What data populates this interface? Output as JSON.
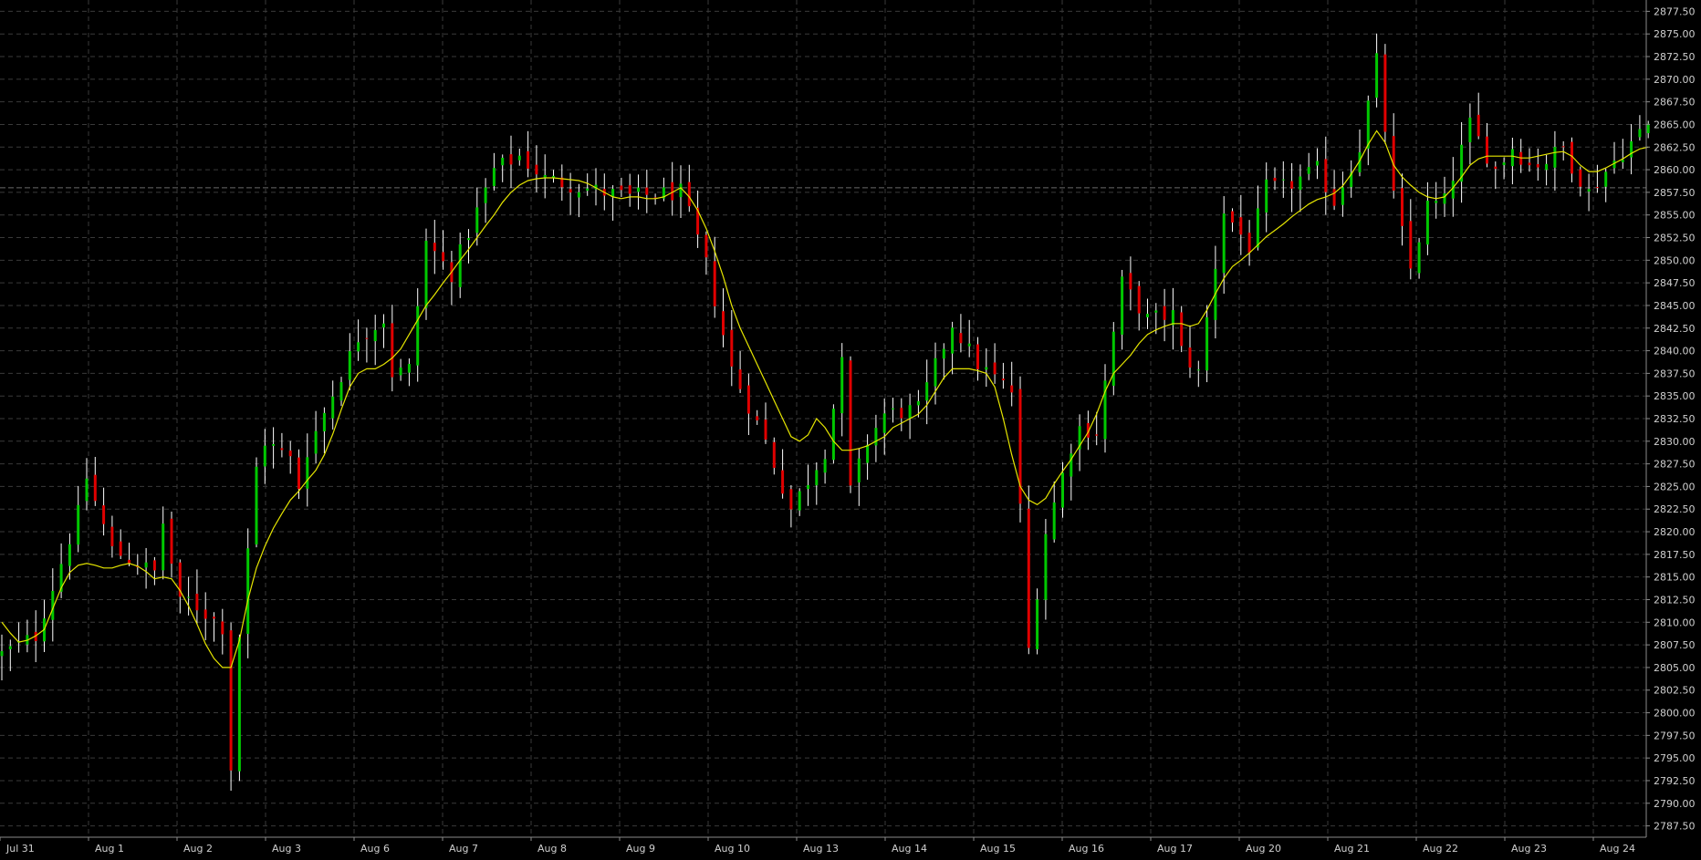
{
  "colors": {
    "background": "#000000",
    "grid": "#3a3a3a",
    "bull": "#00c800",
    "bear": "#e00000",
    "wick": "#ffffff",
    "moving_average": "#e6e600",
    "crosshair": "#6a6a6a",
    "axis_text": "#cfcfcf"
  },
  "chart_data": {
    "type": "candlestick",
    "title": "",
    "xlabel": "",
    "ylabel": "",
    "ylim": [
      2786.25,
      2878.75
    ],
    "y_ticks": [
      "2787.50",
      "2790.00",
      "2792.50",
      "2795.00",
      "2797.50",
      "2800.00",
      "2802.50",
      "2805.00",
      "2807.50",
      "2810.00",
      "2812.50",
      "2815.00",
      "2817.50",
      "2820.00",
      "2822.50",
      "2825.00",
      "2827.50",
      "2830.00",
      "2832.50",
      "2835.00",
      "2837.50",
      "2840.00",
      "2842.50",
      "2845.00",
      "2847.50",
      "2850.00",
      "2852.50",
      "2855.00",
      "2857.50",
      "2860.00",
      "2862.50",
      "2865.00",
      "2867.50",
      "2870.00",
      "2872.50",
      "2875.00",
      "2877.50"
    ],
    "x_ticks": [
      "Jul 31",
      "Aug 1",
      "Aug 2",
      "Aug 3",
      "Aug 6",
      "Aug 7",
      "Aug 8",
      "Aug 9",
      "Aug 10",
      "Aug 13",
      "Aug 14",
      "Aug 15",
      "Aug 16",
      "Aug 17",
      "Aug 20",
      "Aug 21",
      "Aug 22",
      "Aug 23",
      "Aug 24"
    ],
    "grid": true,
    "crosshair_price": 2858.0,
    "series": [
      {
        "type": "candlestick",
        "close_path": [
          [
            0,
            2806.5
          ],
          [
            4,
            2808.5
          ],
          [
            9,
            2822.0
          ],
          [
            10,
            2826.0
          ],
          [
            13,
            2818.0
          ],
          [
            18,
            2815.5
          ],
          [
            19,
            2821.0
          ],
          [
            21,
            2812.0
          ],
          [
            22,
            2812.5
          ],
          [
            26,
            2809.5
          ],
          [
            27,
            2794.0
          ],
          [
            28,
            2808.5
          ],
          [
            30,
            2827.0
          ],
          [
            31,
            2830.0
          ],
          [
            34,
            2828.0
          ],
          [
            35,
            2825.0
          ],
          [
            36,
            2829.0
          ],
          [
            42,
            2841.5
          ],
          [
            45,
            2843.5
          ],
          [
            46,
            2837.5
          ],
          [
            48,
            2838.0
          ],
          [
            50,
            2852.0
          ],
          [
            53,
            2848.5
          ],
          [
            58,
            2860.0
          ],
          [
            61,
            2861.5
          ],
          [
            64,
            2859.0
          ],
          [
            71,
            2857.5
          ],
          [
            74,
            2857.0
          ],
          [
            80,
            2857.5
          ],
          [
            81,
            2855.0
          ],
          [
            83,
            2849.5
          ],
          [
            86,
            2838.0
          ],
          [
            90,
            2830.0
          ],
          [
            93,
            2822.5
          ],
          [
            97,
            2829.0
          ],
          [
            99,
            2838.5
          ],
          [
            100,
            2824.5
          ],
          [
            102,
            2830.0
          ],
          [
            104,
            2833.0
          ],
          [
            108,
            2833.5
          ],
          [
            112,
            2843.0
          ],
          [
            115,
            2838.5
          ],
          [
            119,
            2835.5
          ],
          [
            120,
            2822.5
          ],
          [
            121,
            2807.0
          ],
          [
            123,
            2820.0
          ],
          [
            126,
            2829.5
          ],
          [
            127,
            2831.5
          ],
          [
            129,
            2831.0
          ],
          [
            132,
            2847.5
          ],
          [
            135,
            2843.5
          ],
          [
            138,
            2844.0
          ],
          [
            139,
            2840.0
          ],
          [
            141,
            2837.5
          ],
          [
            144,
            2855.5
          ],
          [
            147,
            2851.5
          ],
          [
            149,
            2858.0
          ],
          [
            151,
            2858.0
          ],
          [
            155,
            2860.0
          ],
          [
            157,
            2856.5
          ],
          [
            160,
            2862.5
          ],
          [
            162,
            2872.0
          ],
          [
            164,
            2857.0
          ],
          [
            166,
            2849.0
          ],
          [
            168,
            2856.0
          ],
          [
            170,
            2856.5
          ],
          [
            173,
            2865.0
          ],
          [
            176,
            2860.0
          ],
          [
            178,
            2862.5
          ],
          [
            180,
            2860.5
          ],
          [
            182,
            2861.0
          ],
          [
            184,
            2862.5
          ],
          [
            185,
            2860.5
          ],
          [
            187,
            2857.5
          ],
          [
            190,
            2861.0
          ],
          [
            193,
            2864.0
          ],
          [
            194,
            2865.0
          ]
        ],
        "moving_average": [
          [
            0,
            2810.0
          ],
          [
            1,
            2808.8
          ],
          [
            2,
            2807.8
          ],
          [
            3,
            2808.0
          ],
          [
            4,
            2808.5
          ],
          [
            5,
            2809.2
          ],
          [
            6,
            2811.5
          ],
          [
            7,
            2813.8
          ],
          [
            8,
            2815.5
          ],
          [
            9,
            2816.3
          ],
          [
            10,
            2816.5
          ],
          [
            11,
            2816.3
          ],
          [
            12,
            2816.0
          ],
          [
            13,
            2816.0
          ],
          [
            14,
            2816.3
          ],
          [
            15,
            2816.5
          ],
          [
            16,
            2816.2
          ],
          [
            17,
            2815.6
          ],
          [
            18,
            2814.8
          ],
          [
            19,
            2815.0
          ],
          [
            20,
            2814.8
          ],
          [
            21,
            2813.5
          ],
          [
            22,
            2811.8
          ],
          [
            23,
            2809.8
          ],
          [
            24,
            2807.6
          ],
          [
            25,
            2806.0
          ],
          [
            26,
            2805.0
          ],
          [
            27,
            2805.0
          ],
          [
            28,
            2808.0
          ],
          [
            29,
            2812.5
          ],
          [
            30,
            2816.0
          ],
          [
            31,
            2818.4
          ],
          [
            32,
            2820.4
          ],
          [
            33,
            2822.0
          ],
          [
            34,
            2823.5
          ],
          [
            35,
            2824.5
          ],
          [
            36,
            2825.7
          ],
          [
            37,
            2826.8
          ],
          [
            38,
            2828.5
          ],
          [
            39,
            2830.8
          ],
          [
            40,
            2833.5
          ],
          [
            41,
            2836.0
          ],
          [
            42,
            2837.5
          ],
          [
            43,
            2838.0
          ],
          [
            44,
            2838.0
          ],
          [
            45,
            2838.5
          ],
          [
            46,
            2839.2
          ],
          [
            47,
            2840.2
          ],
          [
            48,
            2841.8
          ],
          [
            49,
            2843.4
          ],
          [
            50,
            2845.0
          ],
          [
            51,
            2846.2
          ],
          [
            52,
            2847.5
          ],
          [
            53,
            2848.7
          ],
          [
            54,
            2850.0
          ],
          [
            55,
            2851.2
          ],
          [
            56,
            2852.5
          ],
          [
            57,
            2853.8
          ],
          [
            58,
            2855.0
          ],
          [
            59,
            2856.4
          ],
          [
            60,
            2857.5
          ],
          [
            61,
            2858.3
          ],
          [
            62,
            2858.8
          ],
          [
            63,
            2859.0
          ],
          [
            64,
            2859.1
          ],
          [
            65,
            2859.1
          ],
          [
            66,
            2859.0
          ],
          [
            67,
            2858.9
          ],
          [
            68,
            2858.8
          ],
          [
            69,
            2858.5
          ],
          [
            70,
            2858.0
          ],
          [
            71,
            2857.5
          ],
          [
            72,
            2857.0
          ],
          [
            73,
            2856.8
          ],
          [
            74,
            2857.0
          ],
          [
            75,
            2857.0
          ],
          [
            76,
            2856.8
          ],
          [
            77,
            2856.8
          ],
          [
            78,
            2857.0
          ],
          [
            79,
            2857.5
          ],
          [
            80,
            2858.0
          ],
          [
            81,
            2857.0
          ],
          [
            82,
            2855.5
          ],
          [
            83,
            2853.5
          ],
          [
            84,
            2851.0
          ],
          [
            85,
            2848.2
          ],
          [
            86,
            2845.0
          ],
          [
            87,
            2842.5
          ],
          [
            88,
            2840.5
          ],
          [
            89,
            2838.5
          ],
          [
            90,
            2836.5
          ],
          [
            91,
            2834.5
          ],
          [
            92,
            2832.5
          ],
          [
            93,
            2830.5
          ],
          [
            94,
            2830.0
          ],
          [
            95,
            2830.7
          ],
          [
            96,
            2832.5
          ],
          [
            97,
            2831.5
          ],
          [
            98,
            2830.0
          ],
          [
            99,
            2829.0
          ],
          [
            100,
            2829.0
          ],
          [
            101,
            2829.2
          ],
          [
            102,
            2829.5
          ],
          [
            103,
            2830.0
          ],
          [
            104,
            2830.5
          ],
          [
            105,
            2831.5
          ],
          [
            106,
            2832.0
          ],
          [
            107,
            2832.5
          ],
          [
            108,
            2833.0
          ],
          [
            109,
            2834.0
          ],
          [
            110,
            2835.5
          ],
          [
            111,
            2837.0
          ],
          [
            112,
            2838.0
          ],
          [
            113,
            2838.0
          ],
          [
            114,
            2838.0
          ],
          [
            115,
            2837.8
          ],
          [
            116,
            2837.5
          ],
          [
            117,
            2836.0
          ],
          [
            118,
            2832.5
          ],
          [
            119,
            2828.5
          ],
          [
            120,
            2825.0
          ],
          [
            121,
            2823.5
          ],
          [
            122,
            2823.0
          ],
          [
            123,
            2823.7
          ],
          [
            124,
            2825.3
          ],
          [
            125,
            2826.7
          ],
          [
            126,
            2828.0
          ],
          [
            127,
            2829.5
          ],
          [
            128,
            2831.0
          ],
          [
            129,
            2833.0
          ],
          [
            130,
            2835.5
          ],
          [
            131,
            2837.5
          ],
          [
            132,
            2838.5
          ],
          [
            133,
            2839.5
          ],
          [
            134,
            2840.8
          ],
          [
            135,
            2841.8
          ],
          [
            136,
            2842.3
          ],
          [
            137,
            2842.7
          ],
          [
            138,
            2843.0
          ],
          [
            139,
            2843.0
          ],
          [
            140,
            2842.7
          ],
          [
            141,
            2843.0
          ],
          [
            142,
            2844.5
          ],
          [
            143,
            2846.3
          ],
          [
            144,
            2848.0
          ],
          [
            145,
            2849.3
          ],
          [
            146,
            2850.0
          ],
          [
            147,
            2850.8
          ],
          [
            148,
            2851.7
          ],
          [
            149,
            2852.6
          ],
          [
            150,
            2853.3
          ],
          [
            151,
            2854.0
          ],
          [
            152,
            2854.8
          ],
          [
            153,
            2855.5
          ],
          [
            154,
            2856.2
          ],
          [
            155,
            2856.7
          ],
          [
            156,
            2857.0
          ],
          [
            157,
            2857.4
          ],
          [
            158,
            2858.2
          ],
          [
            159,
            2859.5
          ],
          [
            160,
            2861.0
          ],
          [
            161,
            2862.8
          ],
          [
            162,
            2864.3
          ],
          [
            163,
            2863.0
          ],
          [
            164,
            2860.5
          ],
          [
            165,
            2859.2
          ],
          [
            166,
            2858.3
          ],
          [
            167,
            2857.5
          ],
          [
            168,
            2857.0
          ],
          [
            169,
            2856.8
          ],
          [
            170,
            2857.0
          ],
          [
            171,
            2858.0
          ],
          [
            172,
            2859.2
          ],
          [
            173,
            2860.5
          ],
          [
            174,
            2861.2
          ],
          [
            175,
            2861.5
          ],
          [
            176,
            2861.5
          ],
          [
            177,
            2861.5
          ],
          [
            178,
            2861.5
          ],
          [
            179,
            2861.3
          ],
          [
            180,
            2861.3
          ],
          [
            181,
            2861.5
          ],
          [
            182,
            2861.7
          ],
          [
            183,
            2861.9
          ],
          [
            184,
            2862.0
          ],
          [
            185,
            2861.5
          ],
          [
            186,
            2860.5
          ],
          [
            187,
            2859.8
          ],
          [
            188,
            2859.8
          ],
          [
            189,
            2860.2
          ],
          [
            190,
            2860.7
          ],
          [
            191,
            2861.2
          ],
          [
            192,
            2861.8
          ],
          [
            193,
            2862.3
          ],
          [
            194,
            2862.5
          ]
        ]
      }
    ]
  }
}
